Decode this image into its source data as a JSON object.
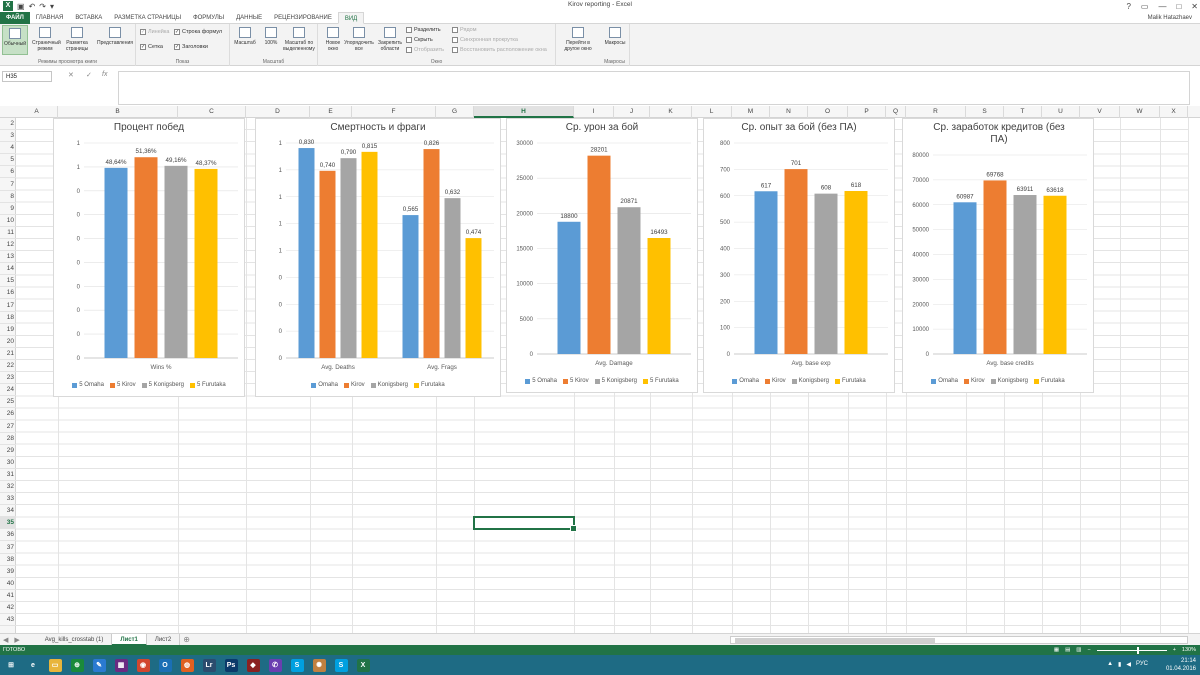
{
  "window": {
    "title": "Kirov reporting - Excel",
    "controls": [
      "?",
      "▭",
      "—",
      "□",
      "✕"
    ],
    "user": "Malik Hatazhaev"
  },
  "quick_access": {
    "logo": "X",
    "icons": [
      "save-icon",
      "undo-icon",
      "redo-icon",
      "customize-icon"
    ]
  },
  "ribbon_tabs": [
    "ФАЙЛ",
    "ГЛАВНАЯ",
    "ВСТАВКА",
    "РАЗМЕТКА СТРАНИЦЫ",
    "ФОРМУЛЫ",
    "ДАННЫЕ",
    "РЕЦЕНЗИРОВАНИЕ",
    "ВИД"
  ],
  "ribbon": {
    "groups": {
      "views": "Режимы просмотра книги",
      "show": "Показ",
      "zoom": "Масштаб",
      "window": "Окно",
      "macros": "Макросы"
    },
    "view_buttons": [
      "Обычный",
      "Страничный режим",
      "Разметка страницы",
      "Представления"
    ],
    "show_checks": [
      {
        "label": "Линейка",
        "checked": true,
        "disabled": true
      },
      {
        "label": "Строка формул",
        "checked": true,
        "disabled": false
      },
      {
        "label": "Сетка",
        "checked": true,
        "disabled": false
      },
      {
        "label": "Заголовки",
        "checked": true,
        "disabled": false
      }
    ],
    "zoom_buttons": [
      "Масштаб",
      "100%",
      "Масштаб по выделенному"
    ],
    "window_buttons": [
      "Новое окно",
      "Упорядочить все",
      "Закрепить области"
    ],
    "window_small": [
      "Разделить",
      "Скрыть",
      "Отобразить"
    ],
    "window_small_disabled": [
      "Рядом",
      "Синхронная прокрутка",
      "Восстановить расположение окна"
    ],
    "switch_window": "Перейти в другое окно",
    "macros_button": "Макросы"
  },
  "formula_bar": {
    "name_box": "H35",
    "formula": ""
  },
  "columns": [
    "A",
    "B",
    "C",
    "D",
    "E",
    "F",
    "G",
    "H",
    "I",
    "J",
    "K",
    "L",
    "M",
    "N",
    "O",
    "P",
    "Q",
    "R",
    "S",
    "T",
    "U",
    "V",
    "W",
    "X"
  ],
  "active_column": "H",
  "rows": [
    "2",
    "3",
    "4",
    "5",
    "6",
    "7",
    "8",
    "9",
    "10",
    "11",
    "12",
    "13",
    "14",
    "15",
    "16",
    "17",
    "18",
    "19",
    "20",
    "21",
    "22",
    "23",
    "24",
    "25",
    "26",
    "27",
    "28",
    "29",
    "30",
    "31",
    "32",
    "33",
    "34",
    "35",
    "36",
    "37",
    "38",
    "39",
    "40",
    "41",
    "42",
    "43"
  ],
  "active_row": "35",
  "colors": {
    "omaha": "#5b9bd5",
    "kirov": "#ed7d31",
    "konigsberg": "#a5a5a5",
    "furutaka": "#ffc000",
    "excel_green": "#217346"
  },
  "charts": [
    {
      "title": "Процент побед",
      "chart_data": {
        "type": "bar",
        "title": "Процент побед",
        "categories": [
          "Wins %"
        ],
        "series": [
          {
            "name": "5 Omaha",
            "values": [
              48.64
            ]
          },
          {
            "name": "5 Kirov",
            "values": [
              51.36
            ]
          },
          {
            "name": "5 Konigsberg",
            "values": [
              49.16
            ]
          },
          {
            "name": "5 Furutaka",
            "values": [
              48.37
            ]
          }
        ],
        "data_labels": [
          "48,64%",
          "51,36%",
          "49,16%",
          "48,37%"
        ],
        "yticks": [
          "1",
          "1",
          "0",
          "0",
          "0",
          "0",
          "0",
          "0",
          "0",
          "0"
        ],
        "ylim": [
          0,
          55
        ],
        "legend": "bottom"
      }
    },
    {
      "title": "Смертность и фраги",
      "chart_data": {
        "type": "bar",
        "title": "Смертность и фраги",
        "categories": [
          "Avg. Deaths",
          "Avg. Frags"
        ],
        "series": [
          {
            "name": "Omaha",
            "values": [
              0.83,
              0.565
            ]
          },
          {
            "name": "Kirov",
            "values": [
              0.74,
              0.826
            ]
          },
          {
            "name": "Konigsberg",
            "values": [
              0.79,
              0.632
            ]
          },
          {
            "name": "Furutaka",
            "values": [
              0.815,
              0.474
            ]
          }
        ],
        "data_labels": [
          [
            "0,830",
            "0,740",
            "0,790",
            "0,815"
          ],
          [
            "0,565",
            "0,826",
            "0,632",
            "0,474"
          ]
        ],
        "yticks": [
          "1",
          "1",
          "1",
          "1",
          "1",
          "0",
          "0",
          "0",
          "0"
        ],
        "ylim": [
          0,
          0.85
        ],
        "legend": "bottom"
      }
    },
    {
      "title": "Ср. урон за бой",
      "chart_data": {
        "type": "bar",
        "title": "Ср. урон за бой",
        "categories": [
          "Avg. Damage"
        ],
        "series": [
          {
            "name": "5 Omaha",
            "values": [
              18800
            ]
          },
          {
            "name": "5 Kirov",
            "values": [
              28201
            ]
          },
          {
            "name": "5 Konigsberg",
            "values": [
              20871
            ]
          },
          {
            "name": "5 Furutaka",
            "values": [
              16493
            ]
          }
        ],
        "data_labels": [
          "18800",
          "28201",
          "20871",
          "16493"
        ],
        "yticks": [
          "30000",
          "25000",
          "20000",
          "15000",
          "10000",
          "5000",
          "0"
        ],
        "ylim": [
          0,
          30000
        ],
        "legend": "bottom"
      }
    },
    {
      "title": "Ср. опыт за бой (без ПА)",
      "chart_data": {
        "type": "bar",
        "title": "Ср. опыт за бой (без ПА)",
        "categories": [
          "Avg. base exp"
        ],
        "series": [
          {
            "name": "Omaha",
            "values": [
              617
            ]
          },
          {
            "name": "Kirov",
            "values": [
              701
            ]
          },
          {
            "name": "Konigsberg",
            "values": [
              608
            ]
          },
          {
            "name": "Furutaka",
            "values": [
              618
            ]
          }
        ],
        "data_labels": [
          "617",
          "701",
          "608",
          "618"
        ],
        "yticks": [
          "800",
          "700",
          "600",
          "500",
          "400",
          "300",
          "200",
          "100",
          "0"
        ],
        "ylim": [
          0,
          800
        ],
        "legend": "bottom"
      }
    },
    {
      "title": "Ср. заработок кредитов (без ПА)",
      "chart_data": {
        "type": "bar",
        "title": "Ср. заработок кредитов (без ПА)",
        "categories": [
          "Avg. base credits"
        ],
        "series": [
          {
            "name": "Omaha",
            "values": [
              60987
            ]
          },
          {
            "name": "Kirov",
            "values": [
              69768
            ]
          },
          {
            "name": "Konigsberg",
            "values": [
              63911
            ]
          },
          {
            "name": "Furutaka",
            "values": [
              63618
            ]
          }
        ],
        "data_labels": [
          "60987",
          "69768",
          "63911",
          "63618"
        ],
        "yticks": [
          "80000",
          "70000",
          "60000",
          "50000",
          "40000",
          "30000",
          "20000",
          "10000",
          "0"
        ],
        "ylim": [
          0,
          80000
        ],
        "legend": "bottom"
      }
    }
  ],
  "sheets": [
    "Avg_kills_crosstab (1)",
    "Лист1",
    "Лист2"
  ],
  "active_sheet": "Лист1",
  "status": {
    "ready": "ГОТОВО",
    "zoom": "130%"
  },
  "taskbar": {
    "apps": [
      "start-icon",
      "ie-icon",
      "explorer-icon",
      "store-icon",
      "app-icon",
      "app-icon-2",
      "chrome-icon",
      "outlook-icon",
      "firefox-icon",
      "lightroom-icon",
      "photoshop-icon",
      "app-icon-3",
      "viber-icon",
      "skype-icon",
      "app-icon-4",
      "skype-icon-2",
      "excel-icon"
    ],
    "app_glyphs": [
      "⊞",
      "e",
      "▭",
      "⊕",
      "✎",
      "▦",
      "◉",
      "O",
      "◍",
      "Lr",
      "Ps",
      "◆",
      "✆",
      "S",
      "✺",
      "S",
      "X"
    ],
    "time": "21:14",
    "date": "01.04.2016",
    "lang": "РУС"
  }
}
